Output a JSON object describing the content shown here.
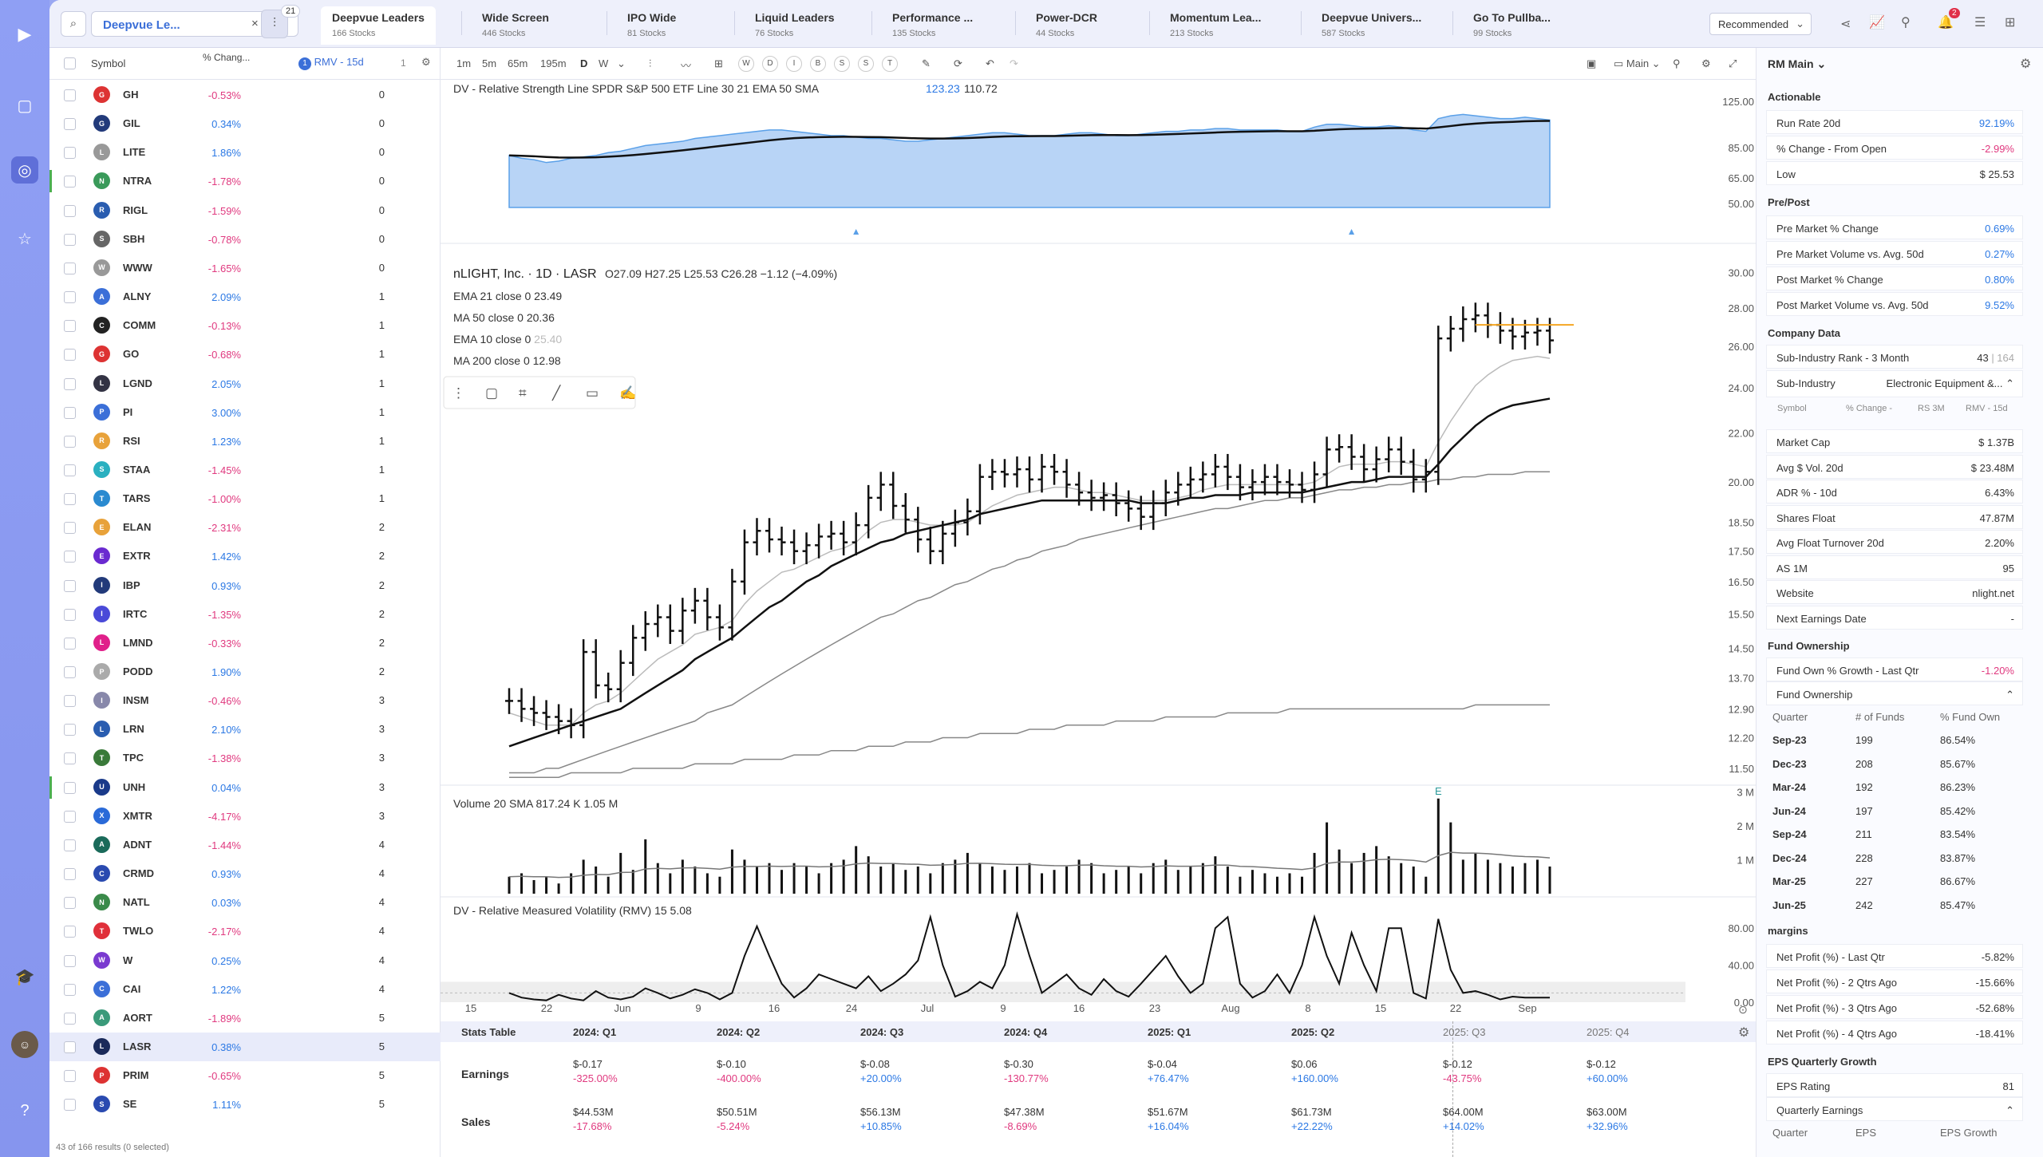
{
  "nav": {
    "icons": [
      "play-logo-icon",
      "dashboard-icon",
      "radar-icon",
      "star-icon",
      "graduation-cap-icon",
      "avatar",
      "help-icon"
    ]
  },
  "topbar": {
    "watchlist_name": "Deepvue Le...",
    "filter_count": "21",
    "tabs": [
      {
        "label": "Deepvue Leaders",
        "count": "166 Stocks"
      },
      {
        "label": "Wide Screen",
        "count": "446 Stocks"
      },
      {
        "label": "IPO Wide",
        "count": "81 Stocks"
      },
      {
        "label": "Liquid Leaders",
        "count": "76 Stocks"
      },
      {
        "label": "Performance ...",
        "count": "135 Stocks"
      },
      {
        "label": "Power-DCR",
        "count": "44 Stocks"
      },
      {
        "label": "Momentum Lea...",
        "count": "213 Stocks"
      },
      {
        "label": "Deepvue Univers...",
        "count": "587 Stocks"
      },
      {
        "label": "Go To Pullba...",
        "count": "99 Stocks"
      }
    ],
    "sort": "Recommended",
    "notifications": "2"
  },
  "list": {
    "headers": {
      "symbol": "Symbol",
      "pct": "% Chang...",
      "rmv": "RMV - 15d",
      "num": "1"
    },
    "rows": [
      {
        "sym": "GH",
        "pct": "-0.53%",
        "rmv": "0",
        "color": "#d33"
      },
      {
        "sym": "GIL",
        "pct": "0.34%",
        "rmv": "0",
        "color": "#223a7a"
      },
      {
        "sym": "LITE",
        "pct": "1.86%",
        "rmv": "0",
        "color": "#999"
      },
      {
        "sym": "NTRA",
        "pct": "-1.78%",
        "rmv": "0",
        "color": "#3a9a5a"
      },
      {
        "sym": "RIGL",
        "pct": "-1.59%",
        "rmv": "0",
        "color": "#2a5db0"
      },
      {
        "sym": "SBH",
        "pct": "-0.78%",
        "rmv": "0",
        "color": "#666"
      },
      {
        "sym": "WWW",
        "pct": "-1.65%",
        "rmv": "0",
        "color": "#999"
      },
      {
        "sym": "ALNY",
        "pct": "2.09%",
        "rmv": "1",
        "color": "#3b6fd8"
      },
      {
        "sym": "COMM",
        "pct": "-0.13%",
        "rmv": "1",
        "color": "#222"
      },
      {
        "sym": "GO",
        "pct": "-0.68%",
        "rmv": "1",
        "color": "#d33"
      },
      {
        "sym": "LGND",
        "pct": "2.05%",
        "rmv": "1",
        "color": "#334"
      },
      {
        "sym": "PI",
        "pct": "3.00%",
        "rmv": "1",
        "color": "#3b6fd8"
      },
      {
        "sym": "RSI",
        "pct": "1.23%",
        "rmv": "1",
        "color": "#e8a23a"
      },
      {
        "sym": "STAA",
        "pct": "-1.45%",
        "rmv": "1",
        "color": "#2ab0c0"
      },
      {
        "sym": "TARS",
        "pct": "-1.00%",
        "rmv": "1",
        "color": "#2a8ad0"
      },
      {
        "sym": "ELAN",
        "pct": "-2.31%",
        "rmv": "2",
        "color": "#e8a23a"
      },
      {
        "sym": "EXTR",
        "pct": "1.42%",
        "rmv": "2",
        "color": "#6a2ad0"
      },
      {
        "sym": "IBP",
        "pct": "0.93%",
        "rmv": "2",
        "color": "#223a7a"
      },
      {
        "sym": "IRTC",
        "pct": "-1.35%",
        "rmv": "2",
        "color": "#4a4ad8"
      },
      {
        "sym": "LMND",
        "pct": "-0.33%",
        "rmv": "2",
        "color": "#e0208a"
      },
      {
        "sym": "PODD",
        "pct": "1.90%",
        "rmv": "2",
        "color": "#aaa"
      },
      {
        "sym": "INSM",
        "pct": "-0.46%",
        "rmv": "3",
        "color": "#88a"
      },
      {
        "sym": "LRN",
        "pct": "2.10%",
        "rmv": "3",
        "color": "#2a5db0"
      },
      {
        "sym": "TPC",
        "pct": "-1.38%",
        "rmv": "3",
        "color": "#3a7a3a"
      },
      {
        "sym": "UNH",
        "pct": "0.04%",
        "rmv": "3",
        "color": "#1a3a8a"
      },
      {
        "sym": "XMTR",
        "pct": "-4.17%",
        "rmv": "3",
        "color": "#2a6ad8"
      },
      {
        "sym": "ADNT",
        "pct": "-1.44%",
        "rmv": "4",
        "color": "#1a6a5a"
      },
      {
        "sym": "CRMD",
        "pct": "0.93%",
        "rmv": "4",
        "color": "#2a4ab0"
      },
      {
        "sym": "NATL",
        "pct": "0.03%",
        "rmv": "4",
        "color": "#3a8a4a"
      },
      {
        "sym": "TWLO",
        "pct": "-2.17%",
        "rmv": "4",
        "color": "#e0303a"
      },
      {
        "sym": "W",
        "pct": "0.25%",
        "rmv": "4",
        "color": "#7a3ad0"
      },
      {
        "sym": "CAI",
        "pct": "1.22%",
        "rmv": "4",
        "color": "#3b6fd8"
      },
      {
        "sym": "AORT",
        "pct": "-1.89%",
        "rmv": "5",
        "color": "#3a9a7a"
      },
      {
        "sym": "LASR",
        "pct": "0.38%",
        "rmv": "5",
        "color": "#1a2a5a"
      },
      {
        "sym": "PRIM",
        "pct": "-0.65%",
        "rmv": "5",
        "color": "#d33"
      },
      {
        "sym": "SE",
        "pct": "1.11%",
        "rmv": "5",
        "color": "#2a4ab0"
      }
    ],
    "footer": "43 of 166 results (0 selected)"
  },
  "chart_toolbar": {
    "intervals": [
      "1m",
      "5m",
      "65m",
      "195m",
      "D",
      "W"
    ],
    "periods": [
      "W",
      "D",
      "I",
      "B",
      "S",
      "S",
      "T"
    ],
    "layout": "Main"
  },
  "chart_data": {
    "type": "line",
    "symbol": "LASR",
    "title": "nLIGHT, Inc. · 1D · LASR",
    "ohlc": "O27.09 H27.25 L25.53 C26.28 −1.12 (−4.09%)",
    "legend": [
      {
        "name": "EMA 21 close 0",
        "value": "23.49"
      },
      {
        "name": "MA 50 close 0",
        "value": "20.36"
      },
      {
        "name": "EMA 10 close 0",
        "value": "25.40"
      },
      {
        "name": "MA 200 close 0",
        "value": "12.98"
      }
    ],
    "rs_label": "DV - Relative Strength Line SPDR S&P 500 ETF Line 30 21 EMA 50 SMA",
    "rs_values": [
      "123.23",
      "110.72"
    ],
    "rs_axis": [
      "125.00",
      "85.00",
      "65.00",
      "50.00"
    ],
    "price_axis": [
      "30.00",
      "28.00",
      "26.00",
      "24.00",
      "22.00",
      "20.00",
      "18.50",
      "17.50",
      "16.50",
      "15.50",
      "14.50",
      "13.70",
      "12.90",
      "12.20",
      "11.50"
    ],
    "volume_label": "Volume 20 SMA",
    "volume_values": [
      "817.24 K",
      "1.05 M"
    ],
    "volume_axis": [
      "3 M",
      "2 M",
      "1 M"
    ],
    "rmv_label": "DV - Relative Measured Volatility (RMV) 15",
    "rmv_value": "5.08",
    "rmv_axis": [
      "80.00",
      "40.00",
      "0.00"
    ],
    "x_labels": [
      "15",
      "22",
      "Jun",
      "9",
      "16",
      "24",
      "Jul",
      "9",
      "16",
      "23",
      "Aug",
      "8",
      "15",
      "22",
      "Sep"
    ],
    "close": [
      13.1,
      12.9,
      12.8,
      12.7,
      12.6,
      12.5,
      14.4,
      13.5,
      13.4,
      14.1,
      14.8,
      15.2,
      15.4,
      15.0,
      15.6,
      15.9,
      15.4,
      15.1,
      16.5,
      17.8,
      18.2,
      17.9,
      17.8,
      17.5,
      17.7,
      18.0,
      18.1,
      17.8,
      18.4,
      19.4,
      19.9,
      19.1,
      18.6,
      17.9,
      17.5,
      18.1,
      18.5,
      18.9,
      20.2,
      20.4,
      20.3,
      20.5,
      20.1,
      20.6,
      20.4,
      19.9,
      19.6,
      19.4,
      19.5,
      19.2,
      19.0,
      18.7,
      19.2,
      19.6,
      19.9,
      20.1,
      20.3,
      20.6,
      20.2,
      19.8,
      20.0,
      20.2,
      20.0,
      19.9,
      19.7,
      20.3,
      21.3,
      21.4,
      21.0,
      20.5,
      20.9,
      21.3,
      20.8,
      20.1,
      20.4,
      26.4,
      26.9,
      27.4,
      27.6,
      27.1,
      26.8,
      26.5,
      26.7,
      26.8,
      26.3
    ],
    "ema21": [
      12.0,
      12.1,
      12.2,
      12.3,
      12.4,
      12.5,
      12.6,
      12.7,
      12.8,
      12.9,
      13.1,
      13.3,
      13.5,
      13.7,
      13.9,
      14.2,
      14.4,
      14.6,
      14.8,
      15.1,
      15.4,
      15.7,
      15.9,
      16.2,
      16.5,
      16.7,
      17.0,
      17.2,
      17.4,
      17.6,
      17.8,
      17.9,
      18.1,
      18.2,
      18.3,
      18.4,
      18.5,
      18.6,
      18.8,
      18.9,
      19.0,
      19.1,
      19.2,
      19.3,
      19.3,
      19.3,
      19.3,
      19.3,
      19.3,
      19.3,
      19.3,
      19.2,
      19.2,
      19.2,
      19.3,
      19.4,
      19.4,
      19.5,
      19.5,
      19.5,
      19.6,
      19.6,
      19.6,
      19.6,
      19.6,
      19.7,
      19.8,
      19.9,
      20.0,
      20.0,
      20.1,
      20.2,
      20.2,
      20.2,
      20.2,
      20.7,
      21.3,
      21.8,
      22.3,
      22.7,
      23.0,
      23.2,
      23.3,
      23.4,
      23.5
    ],
    "ema10": [
      12.8,
      12.7,
      12.6,
      12.5,
      12.5,
      12.5,
      12.8,
      13.0,
      13.1,
      13.3,
      13.6,
      13.9,
      14.2,
      14.4,
      14.6,
      14.9,
      15.0,
      15.1,
      15.3,
      15.8,
      16.2,
      16.5,
      16.8,
      16.9,
      17.1,
      17.3,
      17.5,
      17.6,
      17.8,
      18.2,
      18.5,
      18.6,
      18.6,
      18.5,
      18.4,
      18.4,
      18.4,
      18.5,
      18.8,
      19.1,
      19.3,
      19.5,
      19.6,
      19.7,
      19.8,
      19.8,
      19.7,
      19.6,
      19.6,
      19.5,
      19.4,
      19.3,
      19.3,
      19.3,
      19.4,
      19.5,
      19.7,
      19.8,
      19.9,
      19.9,
      19.9,
      19.9,
      19.9,
      19.9,
      19.9,
      20.0,
      20.3,
      20.6,
      20.7,
      20.7,
      20.7,
      20.8,
      20.8,
      20.7,
      20.6,
      21.6,
      22.5,
      23.3,
      24.1,
      24.6,
      25.0,
      25.3,
      25.4,
      25.5,
      25.4
    ],
    "ma50": [
      11.4,
      11.4,
      11.4,
      11.5,
      11.5,
      11.6,
      11.7,
      11.8,
      11.9,
      12.0,
      12.1,
      12.2,
      12.3,
      12.4,
      12.5,
      12.6,
      12.8,
      12.9,
      13.0,
      13.2,
      13.4,
      13.6,
      13.8,
      14.0,
      14.2,
      14.4,
      14.6,
      14.8,
      15.0,
      15.2,
      15.4,
      15.5,
      15.7,
      15.9,
      16.0,
      16.2,
      16.4,
      16.5,
      16.7,
      16.9,
      17.0,
      17.2,
      17.3,
      17.5,
      17.6,
      17.7,
      17.9,
      18.0,
      18.1,
      18.2,
      18.3,
      18.4,
      18.5,
      18.6,
      18.7,
      18.8,
      18.9,
      19.0,
      19.0,
      19.1,
      19.2,
      19.3,
      19.3,
      19.4,
      19.4,
      19.5,
      19.6,
      19.7,
      19.7,
      19.8,
      19.8,
      19.9,
      19.9,
      20.0,
      20.0,
      20.1,
      20.1,
      20.2,
      20.2,
      20.3,
      20.3,
      20.3,
      20.4,
      20.4,
      20.4
    ],
    "ma200": [
      11.3,
      11.3,
      11.3,
      11.3,
      11.3,
      11.4,
      11.4,
      11.4,
      11.4,
      11.4,
      11.5,
      11.5,
      11.5,
      11.5,
      11.5,
      11.6,
      11.6,
      11.6,
      11.6,
      11.7,
      11.7,
      11.7,
      11.7,
      11.8,
      11.8,
      11.8,
      11.9,
      11.9,
      11.9,
      12.0,
      12.0,
      12.0,
      12.1,
      12.1,
      12.1,
      12.2,
      12.2,
      12.2,
      12.3,
      12.3,
      12.3,
      12.3,
      12.4,
      12.4,
      12.4,
      12.5,
      12.5,
      12.5,
      12.5,
      12.6,
      12.6,
      12.6,
      12.6,
      12.7,
      12.7,
      12.7,
      12.7,
      12.7,
      12.8,
      12.8,
      12.8,
      12.8,
      12.8,
      12.9,
      12.9,
      12.9,
      12.9,
      12.9,
      12.9,
      12.9,
      12.9,
      12.9,
      12.9,
      12.9,
      12.9,
      12.9,
      12.9,
      12.9,
      13.0,
      13.0,
      13.0,
      13.0,
      13.0,
      13.0,
      13.0
    ],
    "volume_m": [
      0.5,
      0.6,
      0.4,
      0.5,
      0.3,
      0.6,
      1.0,
      0.8,
      0.5,
      1.2,
      0.7,
      1.6,
      0.9,
      0.6,
      1.0,
      0.8,
      0.6,
      0.5,
      1.3,
      1.0,
      0.8,
      0.9,
      0.7,
      0.9,
      0.8,
      0.6,
      0.9,
      1.0,
      1.4,
      1.1,
      0.8,
      0.9,
      0.7,
      0.8,
      0.6,
      0.9,
      1.0,
      1.2,
      0.9,
      0.8,
      0.7,
      0.8,
      0.9,
      0.6,
      0.7,
      0.8,
      1.0,
      0.9,
      0.6,
      0.7,
      0.8,
      0.6,
      0.9,
      1.0,
      0.7,
      0.8,
      0.9,
      1.1,
      0.8,
      0.5,
      0.7,
      0.6,
      0.5,
      0.6,
      0.5,
      1.2,
      2.1,
      1.3,
      0.9,
      1.2,
      1.4,
      1.1,
      0.9,
      0.8,
      0.5,
      2.8,
      2.1,
      1.0,
      1.2,
      1.0,
      0.9,
      0.8,
      0.9,
      1.0,
      0.8
    ],
    "rmv": [
      10,
      5,
      3,
      2,
      8,
      4,
      2,
      12,
      5,
      3,
      6,
      15,
      10,
      4,
      8,
      14,
      10,
      3,
      10,
      50,
      82,
      50,
      20,
      5,
      15,
      30,
      25,
      20,
      15,
      28,
      12,
      20,
      30,
      45,
      92,
      40,
      6,
      12,
      22,
      15,
      40,
      95,
      50,
      10,
      20,
      30,
      15,
      8,
      25,
      12,
      6,
      20,
      35,
      50,
      28,
      10,
      20,
      80,
      92,
      20,
      5,
      12,
      30,
      10,
      40,
      92,
      50,
      20,
      75,
      40,
      12,
      80,
      80,
      10,
      4,
      90,
      35,
      10,
      12,
      8,
      3,
      6,
      5,
      5,
      5
    ],
    "rs": [
      98,
      96,
      95,
      93,
      94,
      96,
      97,
      98,
      100,
      101,
      103,
      105,
      106,
      107,
      108,
      110,
      111,
      112,
      113,
      114,
      115,
      116,
      116,
      115,
      114,
      113,
      112,
      112,
      111,
      110,
      110,
      109,
      108,
      108,
      109,
      110,
      111,
      112,
      113,
      114,
      114,
      113,
      112,
      112,
      112,
      113,
      114,
      114,
      113,
      112,
      112,
      113,
      114,
      115,
      115,
      116,
      116,
      117,
      117,
      116,
      116,
      116,
      116,
      115,
      115,
      118,
      120,
      120,
      119,
      118,
      118,
      119,
      118,
      116,
      115,
      124,
      126,
      127,
      126,
      125,
      124,
      124,
      125,
      124,
      123
    ]
  },
  "stats": {
    "title": "Stats Table",
    "columns": [
      "2024: Q1",
      "2024: Q2",
      "2024: Q3",
      "2024: Q4",
      "2025: Q1",
      "2025: Q2",
      "2025: Q3",
      "2025: Q4"
    ],
    "earnings": [
      [
        "$-0.17",
        "-325.00%"
      ],
      [
        "$-0.10",
        "-400.00%"
      ],
      [
        "$-0.08",
        "+20.00%"
      ],
      [
        "$-0.30",
        "-130.77%"
      ],
      [
        "$-0.04",
        "+76.47%"
      ],
      [
        "$0.06",
        "+160.00%"
      ],
      [
        "$-0.12",
        "-43.75%"
      ],
      [
        "$-0.12",
        "+60.00%"
      ]
    ],
    "sales": [
      [
        "$44.53M",
        "-17.68%"
      ],
      [
        "$50.51M",
        "-5.24%"
      ],
      [
        "$56.13M",
        "+10.85%"
      ],
      [
        "$47.38M",
        "-8.69%"
      ],
      [
        "$51.67M",
        "+16.04%"
      ],
      [
        "$61.73M",
        "+22.22%"
      ],
      [
        "$64.00M",
        "+14.02%"
      ],
      [
        "$63.00M",
        "+32.96%"
      ]
    ],
    "row_labels": [
      "Earnings",
      "Sales"
    ]
  },
  "right": {
    "title": "RM Main",
    "actionable": {
      "title": "Actionable",
      "rows": [
        [
          "Run Rate 20d",
          "92.19%"
        ],
        [
          "% Change - From Open",
          "-2.99%"
        ],
        [
          "Low",
          "$ 25.53"
        ]
      ]
    },
    "prepost": {
      "title": "Pre/Post",
      "rows": [
        [
          "Pre Market % Change",
          "0.69%"
        ],
        [
          "Pre Market Volume vs. Avg. 50d",
          "0.27%"
        ],
        [
          "Post Market % Change",
          "0.80%"
        ],
        [
          "Post Market Volume vs. Avg. 50d",
          "9.52%"
        ]
      ]
    },
    "company": {
      "title": "Company Data",
      "rank_label": "Sub-Industry Rank - 3 Month",
      "rank": "43",
      "rank_of": "164",
      "subind_label": "Sub-Industry",
      "subind": "Electronic Equipment &...",
      "subhead": [
        "Symbol",
        "% Change -",
        "RS 3M",
        "RMV - 15d"
      ],
      "rows": [
        [
          "Market Cap",
          "$ 1.37B"
        ],
        [
          "Avg $ Vol. 20d",
          "$ 23.48M"
        ],
        [
          "ADR % - 10d",
          "6.43%"
        ],
        [
          "Shares Float",
          "47.87M"
        ],
        [
          "Avg Float Turnover 20d",
          "2.20%"
        ],
        [
          "AS 1M",
          "95"
        ],
        [
          "Website",
          "nlight.net"
        ],
        [
          "Next Earnings Date",
          "-"
        ]
      ]
    },
    "fund": {
      "title": "Fund Ownership",
      "growth_label": "Fund Own % Growth - Last Qtr",
      "growth": "-1.20%",
      "sub": "Fund Ownership",
      "heads": [
        "Quarter",
        "# of Funds",
        "% Fund Own"
      ],
      "rows": [
        [
          "Sep-23",
          "199",
          "86.54%"
        ],
        [
          "Dec-23",
          "208",
          "85.67%"
        ],
        [
          "Mar-24",
          "192",
          "86.23%"
        ],
        [
          "Jun-24",
          "197",
          "85.42%"
        ],
        [
          "Sep-24",
          "211",
          "83.54%"
        ],
        [
          "Dec-24",
          "228",
          "83.87%"
        ],
        [
          "Mar-25",
          "227",
          "86.67%"
        ],
        [
          "Jun-25",
          "242",
          "85.47%"
        ]
      ]
    },
    "margins": {
      "title": "margins",
      "rows": [
        [
          "Net Profit (%) - Last Qtr",
          "-5.82%"
        ],
        [
          "Net Profit (%) - 2 Qtrs Ago",
          "-15.66%"
        ],
        [
          "Net Profit (%) - 3 Qtrs Ago",
          "-52.68%"
        ],
        [
          "Net Profit (%) - 4 Qtrs Ago",
          "-18.41%"
        ]
      ]
    },
    "eps": {
      "title": "EPS Quarterly Growth",
      "rating_label": "EPS Rating",
      "rating": "81",
      "sub": "Quarterly Earnings",
      "heads": [
        "Quarter",
        "EPS",
        "EPS Growth"
      ]
    }
  }
}
